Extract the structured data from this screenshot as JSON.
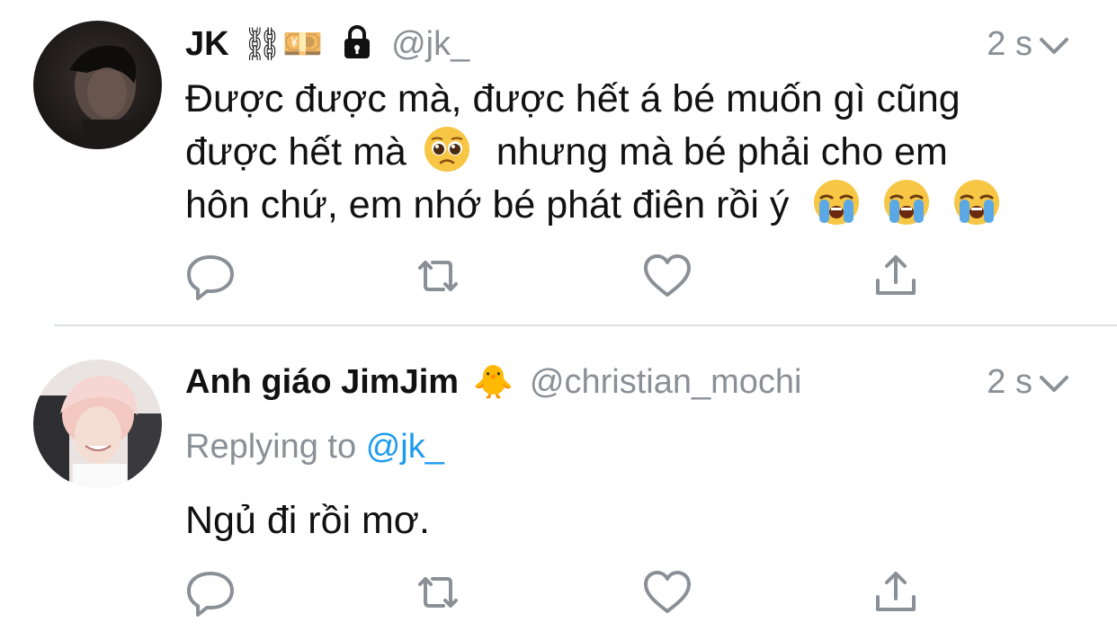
{
  "colors": {
    "text": "#111111",
    "muted": "#8a9096",
    "link": "#1d9bf0",
    "divider": "#dcdfe3",
    "icon": "#8a9096"
  },
  "tweets": [
    {
      "display_name": "JK",
      "name_emojis": "⛓💴",
      "name_icon": "lock-icon",
      "handle": "@jk_",
      "time": "2 s",
      "body_lines": [
        "Được được mà, được hết á bé muốn gì cũng",
        "được hết mà",
        "nhưng mà bé phải cho em",
        "hôn chứ, em nhớ bé phát điên rồi ý"
      ],
      "body_emojis": [
        "pleading-face",
        "loudly-crying-face",
        "loudly-crying-face",
        "loudly-crying-face"
      ]
    },
    {
      "display_name": "Anh giáo JimJim",
      "name_emojis": "🐥",
      "handle": "@christian_mochi",
      "time": "2 s",
      "replying_prefix": "Replying to",
      "replying_mention": "@jk_",
      "body": "Ngủ đi rồi mơ."
    }
  ],
  "action_icons": [
    "reply-icon",
    "retweet-icon",
    "like-icon",
    "share-icon"
  ]
}
